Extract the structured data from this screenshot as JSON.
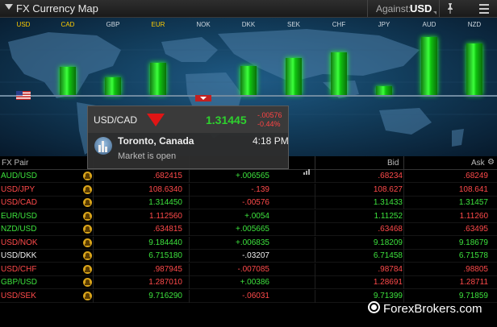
{
  "window": {
    "title": "FX Currency Map",
    "against_label": "Against:",
    "against_value": "USD"
  },
  "map": {
    "currencies": [
      {
        "code": "USD",
        "level": 0.0,
        "color": "#ffcc00"
      },
      {
        "code": "CAD",
        "level": 0.44,
        "color": "#ffcc00"
      },
      {
        "code": "GBP",
        "level": 0.28,
        "color": "#cfd8e0"
      },
      {
        "code": "EUR",
        "level": 0.5,
        "color": "#ffcc00"
      },
      {
        "code": "NOK",
        "level": 0.0,
        "color": "#cfd8e0"
      },
      {
        "code": "DKK",
        "level": 0.45,
        "color": "#cfd8e0"
      },
      {
        "code": "SEK",
        "level": 0.58,
        "color": "#cfd8e0"
      },
      {
        "code": "CHF",
        "level": 0.66,
        "color": "#cfd8e0"
      },
      {
        "code": "JPY",
        "level": 0.14,
        "color": "#cfd8e0"
      },
      {
        "code": "AUD",
        "level": 0.9,
        "color": "#cfd8e0"
      },
      {
        "code": "NZD",
        "level": 0.8,
        "color": "#cfd8e0"
      }
    ]
  },
  "tooltip": {
    "pair": "USD/CAD",
    "price": "1.31445",
    "change": "-.00576",
    "change_pct": "-0.44%",
    "city": "Toronto, Canada",
    "time": "4:18 PM",
    "status": "Market is open"
  },
  "grid": {
    "headers": {
      "pair": "FX Pair",
      "bid": "Bid",
      "ask": "Ask"
    },
    "rows": [
      {
        "pair": "AUD/USD",
        "last": ".682415",
        "net": "+.006565",
        "bid": ".68234",
        "ask": ".68249",
        "pair_color": "green",
        "last_color": "red",
        "net_color": "green",
        "bid_color": "red",
        "ask_color": "red"
      },
      {
        "pair": "USD/JPY",
        "last": "108.6340",
        "net": "-.139",
        "bid": "108.627",
        "ask": "108.641",
        "pair_color": "red",
        "last_color": "red",
        "net_color": "red",
        "bid_color": "red",
        "ask_color": "red"
      },
      {
        "pair": "USD/CAD",
        "last": "1.314450",
        "net": "-.00576",
        "bid": "1.31433",
        "ask": "1.31457",
        "pair_color": "red",
        "last_color": "green",
        "net_color": "red",
        "bid_color": "green",
        "ask_color": "green"
      },
      {
        "pair": "EUR/USD",
        "last": "1.112560",
        "net": "+.0054",
        "bid": "1.11252",
        "ask": "1.11260",
        "pair_color": "green",
        "last_color": "red",
        "net_color": "green",
        "bid_color": "green",
        "ask_color": "red"
      },
      {
        "pair": "NZD/USD",
        "last": ".634815",
        "net": "+.005665",
        "bid": ".63468",
        "ask": ".63495",
        "pair_color": "green",
        "last_color": "red",
        "net_color": "green",
        "bid_color": "red",
        "ask_color": "red"
      },
      {
        "pair": "USD/NOK",
        "last": "9.184440",
        "net": "+.006835",
        "bid": "9.18209",
        "ask": "9.18679",
        "pair_color": "red",
        "last_color": "green",
        "net_color": "green",
        "bid_color": "green",
        "ask_color": "green"
      },
      {
        "pair": "USD/DKK",
        "last": "6.715180",
        "net": "-.03207",
        "bid": "6.71458",
        "ask": "6.71578",
        "pair_color": "white",
        "last_color": "green",
        "net_color": "white",
        "bid_color": "green",
        "ask_color": "green"
      },
      {
        "pair": "USD/CHF",
        "last": ".987945",
        "net": "-.007085",
        "bid": ".98784",
        "ask": ".98805",
        "pair_color": "red",
        "last_color": "red",
        "net_color": "red",
        "bid_color": "red",
        "ask_color": "red"
      },
      {
        "pair": "GBP/USD",
        "last": "1.287010",
        "net": "+.00386",
        "bid": "1.28691",
        "ask": "1.28711",
        "pair_color": "green",
        "last_color": "red",
        "net_color": "green",
        "bid_color": "red",
        "ask_color": "red"
      },
      {
        "pair": "USD/SEK",
        "last": "9.716290",
        "net": "-.06031",
        "bid": "9.71399",
        "ask": "9.71859",
        "pair_color": "red",
        "last_color": "green",
        "net_color": "red",
        "bid_color": "green",
        "ask_color": "green"
      }
    ]
  },
  "watermark": "ForexBrokers.com"
}
